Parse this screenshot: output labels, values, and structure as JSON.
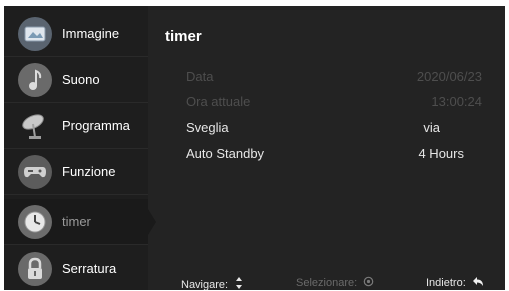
{
  "sidebar": {
    "items": [
      {
        "label": "Immagine",
        "icon": "picture-icon"
      },
      {
        "label": "Suono",
        "icon": "music-note-icon"
      },
      {
        "label": "Programma",
        "icon": "satellite-dish-icon"
      },
      {
        "label": "Funzione",
        "icon": "gamepad-icon"
      },
      {
        "label": "timer",
        "icon": "clock-icon",
        "selected": true
      },
      {
        "label": "Serratura",
        "icon": "lock-icon"
      }
    ]
  },
  "main": {
    "title": "timer",
    "rows": [
      {
        "label": "Data",
        "value": "2020/06/23",
        "enabled": false
      },
      {
        "label": "Ora attuale",
        "value": "13:00:24",
        "enabled": false
      },
      {
        "label": "Sveglia",
        "value": "via",
        "enabled": true
      },
      {
        "label": "Auto Standby",
        "value": "4 Hours",
        "enabled": true
      }
    ]
  },
  "footer": {
    "navigate": {
      "label": "Navigare:",
      "icon": "up-down-arrows-icon"
    },
    "select": {
      "label": "Selezionare:",
      "icon": "ok-circle-icon"
    },
    "back": {
      "label": "Indietro:",
      "icon": "back-arrow-icon"
    }
  }
}
